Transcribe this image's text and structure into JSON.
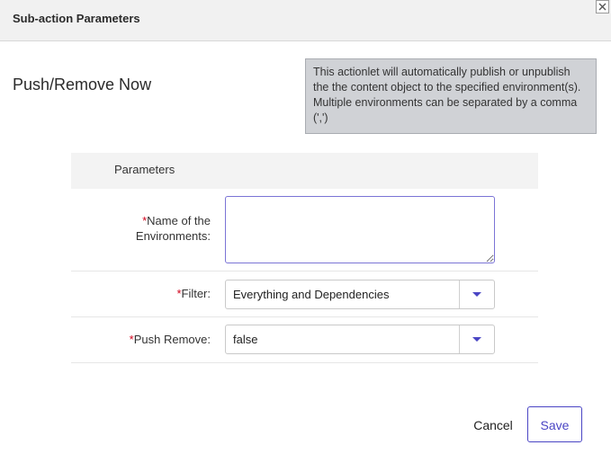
{
  "dialog": {
    "title": "Sub-action Parameters",
    "close_icon": "close-icon"
  },
  "main": {
    "title": "Push/Remove Now",
    "hint": "This actionlet will automatically publish or unpublish the the content object to the specified environment(s). Multiple environments can be separated by a comma (',')"
  },
  "parameters": {
    "header": "Parameters",
    "required_marker": "*",
    "environments": {
      "label_line1": "Name of the",
      "label_line2": "Environments:",
      "value": ""
    },
    "filter": {
      "label": "Filter:",
      "selected": "Everything and Dependencies",
      "icon": "chevron-down-icon"
    },
    "push_remove": {
      "label": "Push Remove:",
      "selected": "false",
      "icon": "chevron-down-icon"
    }
  },
  "footer": {
    "cancel_label": "Cancel",
    "save_label": "Save"
  },
  "colors": {
    "accent": "#4a45c4",
    "required": "#d0021b",
    "hint_bg": "#d0d2d6"
  }
}
